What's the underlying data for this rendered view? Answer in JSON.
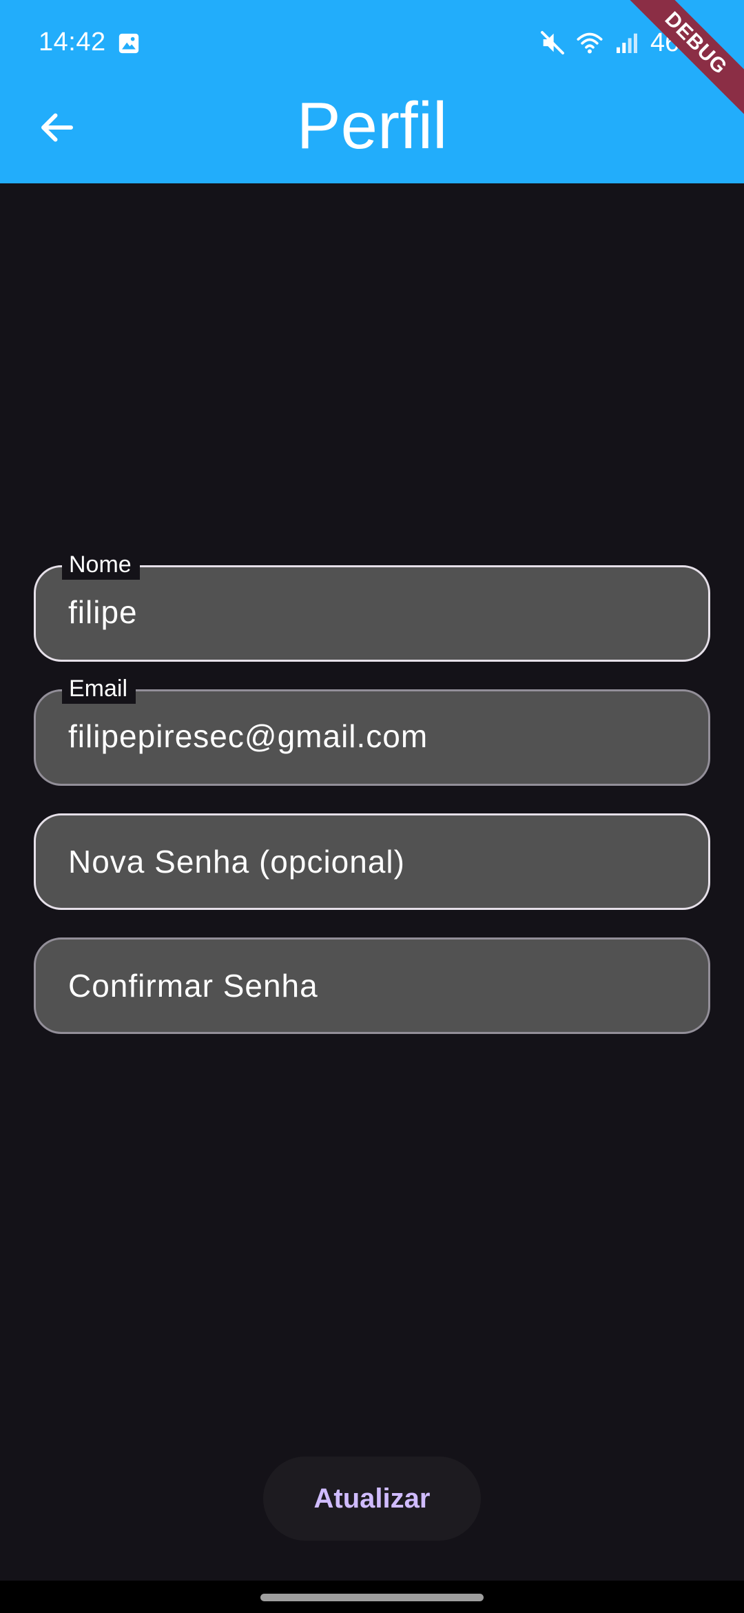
{
  "status_bar": {
    "time": "14:42",
    "battery": "46%",
    "icons": [
      "gallery-icon",
      "mute-icon",
      "wifi-icon",
      "signal-icon"
    ]
  },
  "app_bar": {
    "title": "Perfil",
    "back_icon": "arrow-back-icon",
    "background_color": "#22adfb"
  },
  "debug_banner": "DEBUG",
  "form": {
    "name": {
      "label": "Nome",
      "value": "filipe"
    },
    "email": {
      "label": "Email",
      "value": "filipepiresec@gmail.com"
    },
    "new_password": {
      "placeholder": "Nova Senha (opcional)"
    },
    "confirm_password": {
      "placeholder": "Confirmar Senha"
    }
  },
  "actions": {
    "update_label": "Atualizar",
    "update_color": "#d0bcff"
  }
}
